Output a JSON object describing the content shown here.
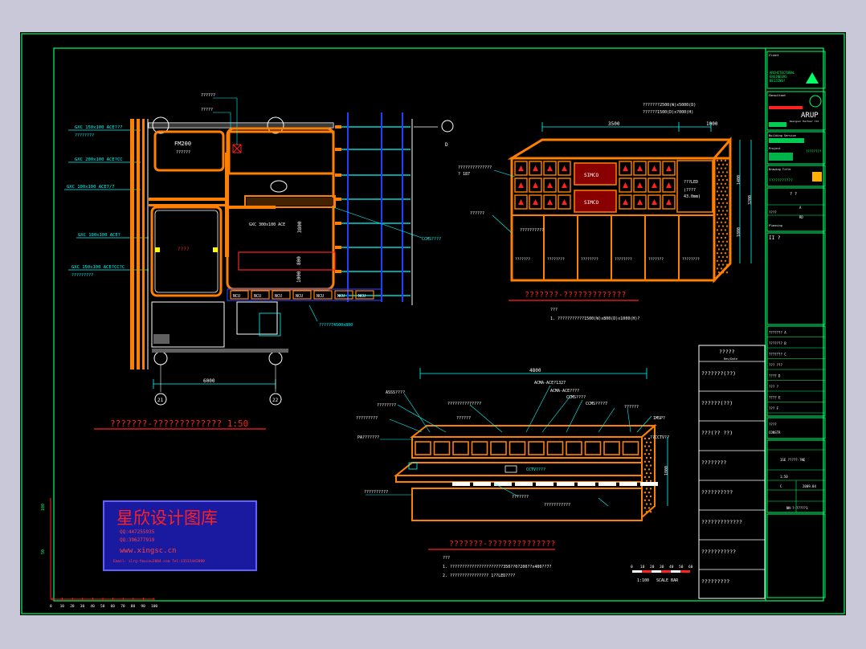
{
  "colors": {
    "background_outer": "#c8c8d8",
    "sheet": "#000000",
    "frame": "#00ff66",
    "orange": "#ff8000",
    "cyan": "#00ffff",
    "red": "#ff2020",
    "white": "#ffffff",
    "blue": "#2040ff",
    "green": "#00e060",
    "yellow": "#ffff00"
  },
  "plan": {
    "title": "???????-????????????? 1:50",
    "dim_width": "6000",
    "grid_left": "21",
    "grid_right": "22",
    "grid_top": "D",
    "labels": {
      "gc1": "GXC 150x100 ACE???",
      "gc1b": "????????",
      "gc2": "GXC 200x100 ACE?CC",
      "gc3": "GXC 100x100 ACE7/7",
      "gc4": "GXC 100x100 ACE?",
      "gc5": "GXC 150x100 ACE?CC?C",
      "gc5b": "?????????",
      "room1": "FM200",
      "room1b": "??????",
      "room2": "????",
      "note1": "??????",
      "note2": "?????",
      "bench": "GXC 300x100 ACE",
      "cabinet": "CCMS????",
      "raised": "?????74500x800",
      "dim_h1": "3800",
      "dim_h2": "1000",
      "dim_h3": "800"
    },
    "units": [
      "NCU",
      "NCU",
      "NCU",
      "NCU",
      "NCU",
      "NCU",
      "NCU"
    ]
  },
  "elevation1": {
    "title": "???????-?????????????",
    "dim_total": "3500",
    "dim_right": "1000",
    "dim_height": "1400",
    "dim_height2": "1800",
    "dim_height3": "3200",
    "header1": "???????2500(W)x5000(D)",
    "header2": "??????1500(D)x?000(H)",
    "screen_label": "SIMCO",
    "left_label1": "??????????????",
    "left_label1b": "? 187",
    "left_label2": "??????",
    "right_label": "???LED",
    "right_label2": "(????",
    "right_label3": "43.0mm)",
    "center_label": "??????????",
    "drawer_labels": [
      "???????",
      "????????",
      "????????",
      "????????",
      "???????",
      "????????"
    ],
    "note_head": "???",
    "note1": "1. ???????????1500(W)x800(D)x1000(H)?"
  },
  "elevation2": {
    "title": "???????-??????????????",
    "dim_total": "4800",
    "dim_height": "1800",
    "labels_top": [
      "ASSS????",
      "ACMA-ACE?1327",
      "ACMA-ACE????",
      "CCMS????",
      "CCMS????7"
    ],
    "labels_left": [
      "?????????",
      "????????",
      "PA???????"
    ],
    "labels_mid": [
      "??????????????",
      "??????"
    ],
    "labels_right": [
      "??????",
      "1MSP?",
      "??CCTV??"
    ],
    "console": "CCTV????",
    "bottom_labels": [
      "??????????",
      "???????",
      "???????????"
    ],
    "note_head": "???",
    "note1": "1. ??????????????????????350??0?200??x400??7?",
    "note2": "2. ???????????????? 1??LED????"
  },
  "scale_bar": {
    "label": "SCALE BAR",
    "ratio": "1:100",
    "ticks": [
      "0",
      "10",
      "20",
      "30",
      "40",
      "50",
      "60"
    ]
  },
  "axis_ruler": {
    "ticks": [
      "0",
      "10",
      "20",
      "30",
      "40",
      "50",
      "60",
      "70",
      "80",
      "90",
      "100"
    ],
    "side": [
      "50",
      "100"
    ]
  },
  "watermark": {
    "title": "星欣设计图库",
    "qq1": "QQ:447255935",
    "qq2": "QQ:396277919",
    "url": "www.xingsc.cn",
    "email": "Email: ilrg-fmucau2004.com  Tel:13515442880"
  },
  "revision_table": {
    "header": "?????",
    "header_sub": "Rev/Date",
    "rows": [
      "???????(??)",
      "??????(??)",
      "???(??    ??)",
      "????????",
      "??????????",
      "?????????????",
      "???????????",
      "?????????"
    ]
  },
  "title_block": {
    "client_label": "Client",
    "company1": "ARCHITECTURAL",
    "company2": "ENGINEERS",
    "company3": "BEIJING?",
    "consultant_label": "Consultant",
    "arup": "ARUP",
    "arup_sub": "Designer Partner ltd",
    "building_label": "Building Service",
    "mep1": "????????",
    "project_label": "Project",
    "project_name": "???????????",
    "drawing_label": "Drawing Title",
    "stamp1": "? ?",
    "field_a": "A",
    "field_sig": "????",
    "field_rd": "RD",
    "field_pl": "Planning",
    "field_ii": "II ?",
    "fields_mid": [
      "??????? A",
      "??????? B",
      "??????? C",
      "??? ???",
      "???? D",
      "??? ?",
      "???? E",
      "??? F"
    ],
    "issue_label": "????",
    "drawing_no": "1SE ?????-?NE",
    "scale": "1:50",
    "rev": "C",
    "date": "2009.04",
    "sheet": "NN-?-?????1",
    "stage": "CONSTR"
  }
}
